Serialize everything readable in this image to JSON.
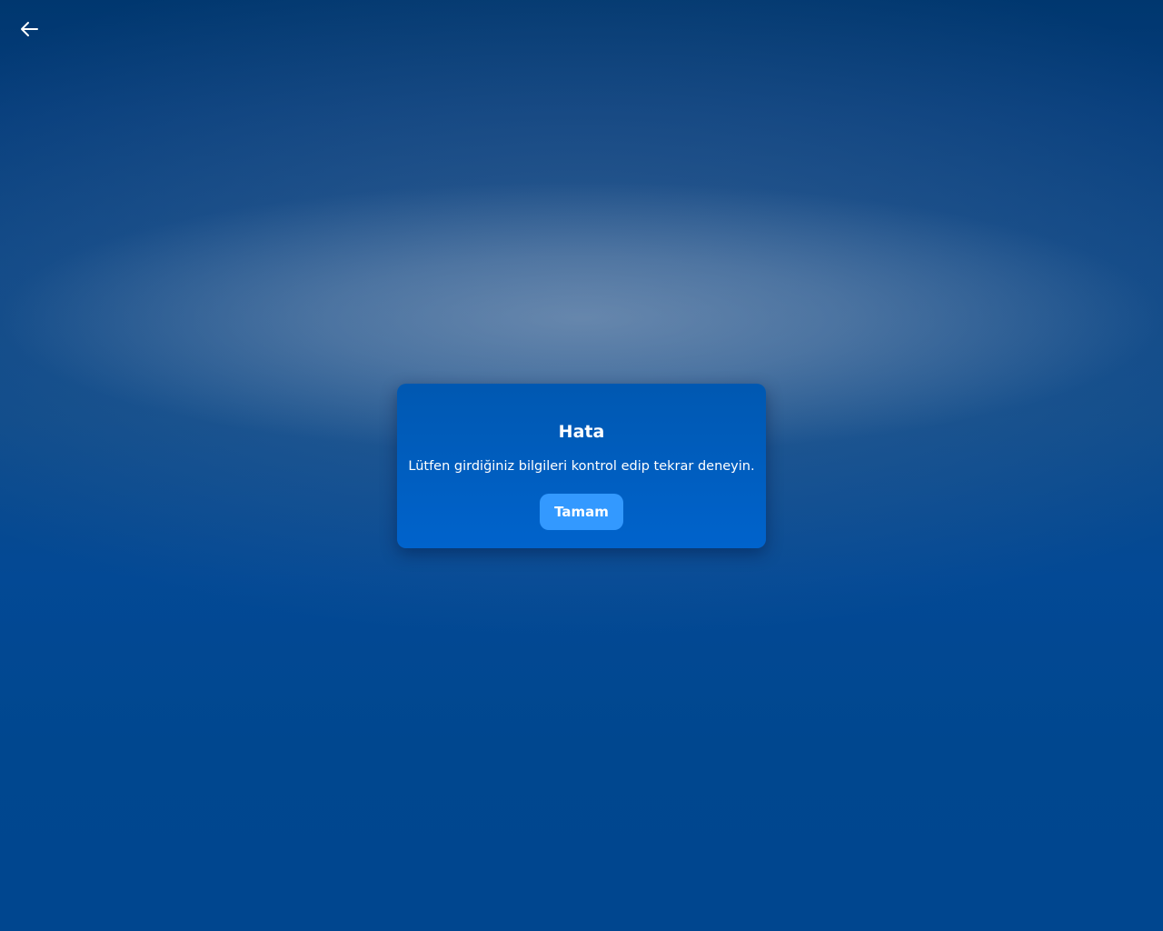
{
  "navigation": {
    "back_icon": "arrow-left-icon"
  },
  "dialog": {
    "title": "Hata",
    "message": "Lütfen girdiğiniz bilgileri kontrol edip tekrar deneyin.",
    "ok_label": "Tamam"
  },
  "colors": {
    "background": "#00468f",
    "dialog_background": "#005fc4",
    "button_background": "#3399ff",
    "text": "#ffffff"
  }
}
